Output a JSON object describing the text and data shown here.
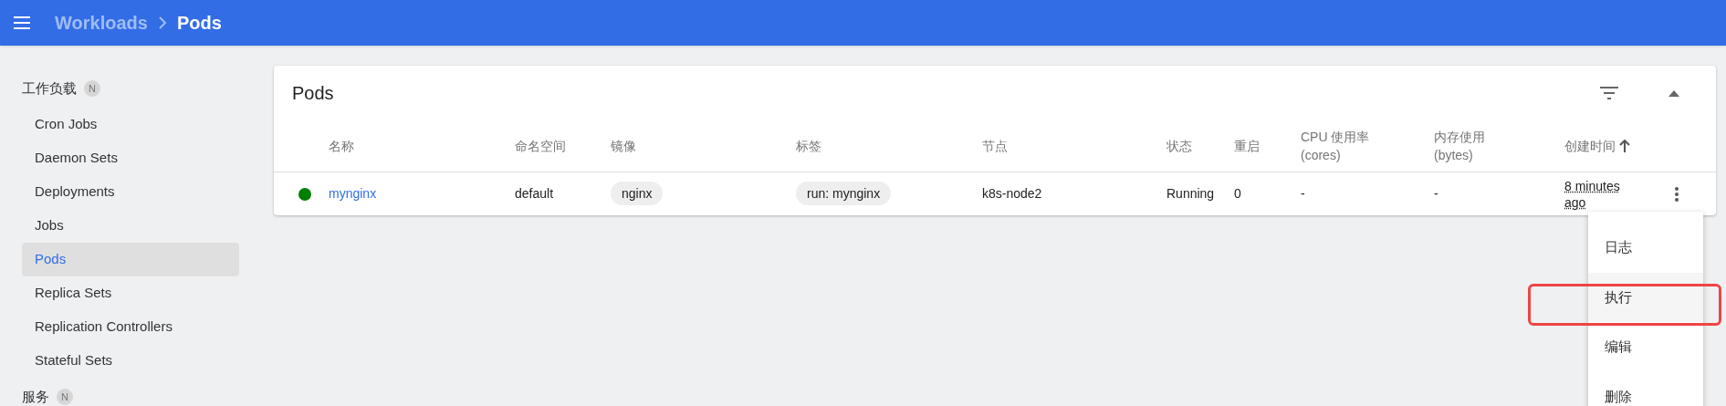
{
  "topbar": {
    "breadcrumb": [
      {
        "label": "Workloads",
        "current": false
      },
      {
        "label": "Pods",
        "current": true
      }
    ]
  },
  "sidebar": {
    "sections": [
      {
        "title": "工作负载",
        "badge": "N",
        "items": [
          {
            "label": "Cron Jobs",
            "selected": false
          },
          {
            "label": "Daemon Sets",
            "selected": false
          },
          {
            "label": "Deployments",
            "selected": false
          },
          {
            "label": "Jobs",
            "selected": false
          },
          {
            "label": "Pods",
            "selected": true
          },
          {
            "label": "Replica Sets",
            "selected": false
          },
          {
            "label": "Replication Controllers",
            "selected": false
          },
          {
            "label": "Stateful Sets",
            "selected": false
          }
        ]
      },
      {
        "title": "服务",
        "badge": "N"
      }
    ]
  },
  "card": {
    "title": "Pods",
    "columns": [
      {
        "label": "名称"
      },
      {
        "label": "命名空间"
      },
      {
        "label": "镜像"
      },
      {
        "label": "标签"
      },
      {
        "label": "节点"
      },
      {
        "label": "状态"
      },
      {
        "label": "重启"
      },
      {
        "label": "CPU 使用率 (cores)"
      },
      {
        "label": "内存使用 (bytes)"
      },
      {
        "label": "创建时间",
        "sorted": true
      }
    ],
    "rows": [
      {
        "color": "#008000",
        "name": "mynginx",
        "namespace": "default",
        "image": "nginx",
        "label": "run: mynginx",
        "node": "k8s-node2",
        "status": "Running",
        "restarts": "0",
        "cpu": "-",
        "memory": "-",
        "created": "8 minutes ago"
      }
    ]
  },
  "menu": {
    "items": [
      {
        "label": "日志",
        "highlighted": false
      },
      {
        "label": "执行",
        "highlighted": true
      },
      {
        "label": "编辑",
        "highlighted": false
      },
      {
        "label": "删除",
        "highlighted": false
      }
    ]
  }
}
